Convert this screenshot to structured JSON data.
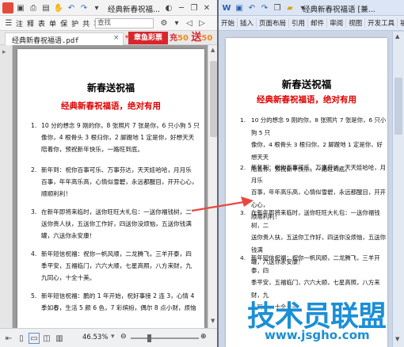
{
  "pdf": {
    "toolbar": {
      "title": "经典新春祝福...",
      "search_placeholder": "查找",
      "menu_letters": [
        "注",
        "释",
        "表",
        "单",
        "保",
        "护",
        "共",
        "享"
      ]
    },
    "tab": {
      "label": "经典新春祝福语.pdf",
      "close": "×"
    },
    "ads": {
      "promo": "章鱼彩票",
      "charge": "充",
      "charge_amount": "50",
      "give": "送",
      "give_amount": "50"
    },
    "page": {
      "title": "新春送祝福",
      "subtitle": "经典新春祝福语，绝对有用",
      "items": [
        {
          "num": "1.",
          "lines": [
            "10 分的想念 9 刚的你，8 张照片 7 张是你，6 只小狗 5 只",
            "像你，4 根骨头 3 根归你，2 脚蹬地 1 定是你，好想天天",
            "陪着你，预祝新年快乐，一路旺到底。"
          ]
        },
        {
          "num": "2.",
          "lines": [
            "新年到：祝你百事可乐、万事芬达，天天娃哈哈，月月乐",
            "百事，年年高乐高，心情似雪碧，永远都醒目，开开心心，",
            "顺顺利利！"
          ]
        },
        {
          "num": "3.",
          "lines": [
            "在新年即将来临时，送你旺旺大礼包：一送你福钱树，二",
            "送你贵人扶，五送你工作好，四送你没烦恼，五送你钱满",
            "罐，六送你永安康！"
          ]
        },
        {
          "num": "4.",
          "lines": [
            "新年短信祝福：祝你一帆风顺，二龙腾飞，三羊开泰，四",
            "季平安，五福临门，六六大顺，七星高照，八方来财，九",
            "九同心，十全十美。"
          ]
        },
        {
          "num": "5.",
          "lines": [
            "新年短信祝福：鹏的 1 年开始，祝好事接 2 连 3，心情 4",
            "季如春，生活 5 颜 6 色，7 彩缤纷，偶尔 8 点小财，烦恼"
          ]
        }
      ]
    },
    "status": {
      "zoom": "46.53%"
    }
  },
  "word": {
    "toolbar": {
      "title": "经典新春祝福语 [兼..."
    },
    "ribbon_tabs": [
      "开始",
      "插入",
      "页面布局",
      "引用",
      "邮件",
      "审阅",
      "视图",
      "开发工具",
      "福昕阅"
    ],
    "page": {
      "title": "新春送祝福",
      "subtitle": "经典新春祝福语，绝对有用",
      "items": [
        {
          "num": "1.",
          "lines": [
            "10 分的想念 9 刚的你，8 张照片 7 张是你，6 只小狗 5 只",
            "像你，4 根骨头 3 根归你，2 脚蹬地 1 定是你，好想天天",
            "陪着你，预祝新年快乐，一路旺到底。"
          ]
        },
        {
          "num": "2.",
          "lines": [
            "新年到：祝你百事可乐、万事芬达，天天娃哈哈，月月乐",
            "百事，年年高乐高，心情似雪碧，永远都醒目，开开心心，",
            "顺顺利利！"
          ]
        },
        {
          "num": "3.",
          "lines": [
            "在新年即将来临时，送你旺旺大礼包：一送你福钱树，二",
            "送你贵人扶，五送你工作好，四送你没烦恼，五送你钱满",
            "罐，六送你永安康！"
          ]
        },
        {
          "num": "4.",
          "lines": [
            "新年短信祝福：祝你一帆风顺，二龙腾飞，三羊开泰，四",
            "季平安，五福临门，六六大顺，七星高照，八方来财，九",
            "九同心，十全十美。"
          ]
        }
      ]
    }
  },
  "watermark": {
    "brand": "技术员联盟",
    "url": "www.jsgho.com"
  },
  "colors": {
    "arrow": "#e8473f",
    "subtitle": "#e00000",
    "ad_red": "#d9262c",
    "watermark_blue": "#1b8fd6"
  }
}
